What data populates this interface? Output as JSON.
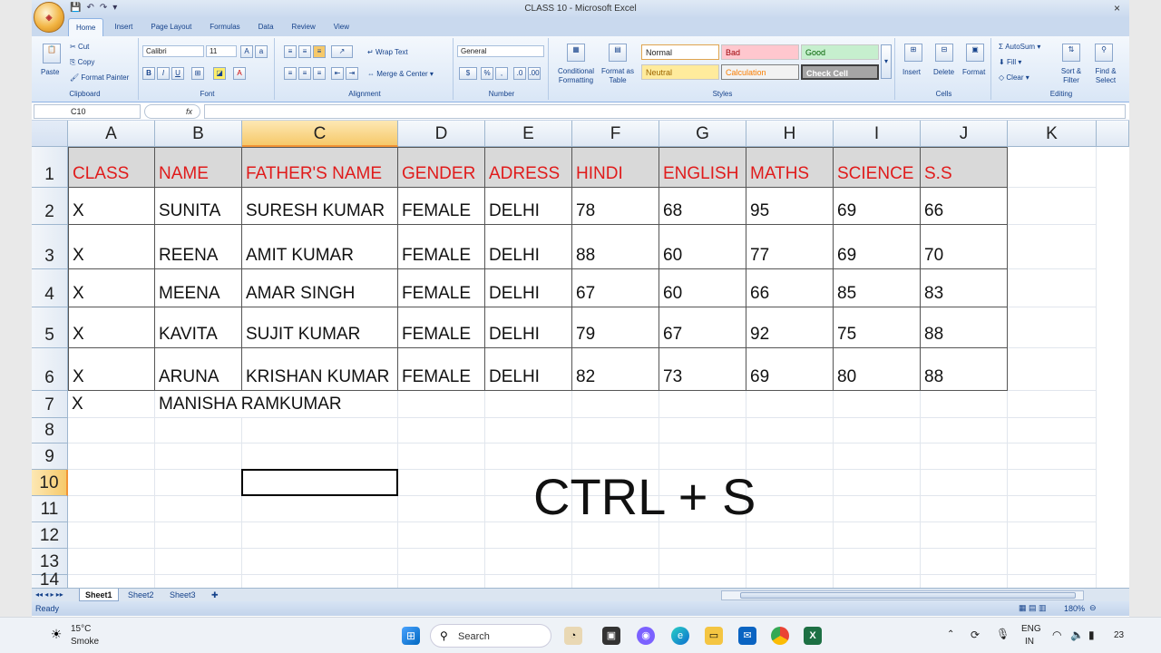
{
  "window": {
    "title": "CLASS 10 - Microsoft Excel",
    "close_glyph": "×"
  },
  "ribbon": {
    "tabs": [
      "Home",
      "Insert",
      "Page Layout",
      "Formulas",
      "Data",
      "Review",
      "View"
    ],
    "clipboard": {
      "cut": "Cut",
      "copy": "Copy",
      "format_painter": "Format Painter",
      "paste": "Paste",
      "label": "Clipboard"
    },
    "font": {
      "name": "Calibri",
      "size": "11",
      "label": "Font"
    },
    "alignment": {
      "wrap": "Wrap Text",
      "merge": "Merge & Center",
      "label": "Alignment"
    },
    "number": {
      "format": "General",
      "label": "Number"
    },
    "styles": {
      "conditional": "Conditional Formatting",
      "format_table": "Format as Table",
      "normal": "Normal",
      "bad": "Bad",
      "good": "Good",
      "neutral": "Neutral",
      "calculation": "Calculation",
      "check": "Check Cell",
      "label": "Styles"
    },
    "cells": {
      "insert": "Insert",
      "delete": "Delete",
      "format": "Format",
      "label": "Cells"
    },
    "editing": {
      "autosum": "AutoSum",
      "fill": "Fill",
      "clear": "Clear",
      "sort": "Sort & Filter",
      "find": "Find & Select",
      "label": "Editing"
    }
  },
  "formula_bar": {
    "name_box": "C10",
    "fx": "fx"
  },
  "columns": [
    "A",
    "B",
    "C",
    "D",
    "E",
    "F",
    "G",
    "H",
    "I",
    "J",
    "K"
  ],
  "rows": [
    "1",
    "2",
    "3",
    "4",
    "5",
    "6",
    "7",
    "8",
    "9",
    "10",
    "11",
    "12",
    "13",
    "14"
  ],
  "table": {
    "headers": [
      "CLASS",
      "NAME",
      "FATHER'S NAME",
      "GENDER",
      "ADRESS",
      "HINDI",
      "ENGLISH",
      "MATHS",
      "SCIENCE",
      "S.S"
    ],
    "rows": [
      [
        "X",
        "SUNITA",
        "SURESH KUMAR",
        "FEMALE",
        "DELHI",
        "78",
        "68",
        "95",
        "69",
        "66"
      ],
      [
        "X",
        "REENA",
        "AMIT KUMAR",
        "FEMALE",
        "DELHI",
        "88",
        "60",
        "77",
        "69",
        "70"
      ],
      [
        "X",
        "MEENA",
        "AMAR SINGH",
        "FEMALE",
        "DELHI",
        "67",
        "60",
        "66",
        "85",
        "83"
      ],
      [
        "X",
        "KAVITA",
        "SUJIT KUMAR",
        "FEMALE",
        "DELHI",
        "79",
        "67",
        "92",
        "75",
        "88"
      ],
      [
        "X",
        "ARUNA",
        "KRISHAN KUMAR",
        "FEMALE",
        "DELHI",
        "82",
        "73",
        "69",
        "80",
        "88"
      ]
    ],
    "row7": [
      "X",
      "MANISHA RAMKUMAR"
    ]
  },
  "overlay_text": "CTRL + S",
  "sheets": [
    "Sheet1",
    "Sheet2",
    "Sheet3"
  ],
  "status": {
    "ready": "Ready",
    "zoom": "180%"
  },
  "taskbar": {
    "weather_temp": "15°C",
    "weather_desc": "Smoke",
    "search": "Search",
    "lang_line1": "ENG",
    "lang_line2": "IN",
    "clock": "23"
  }
}
